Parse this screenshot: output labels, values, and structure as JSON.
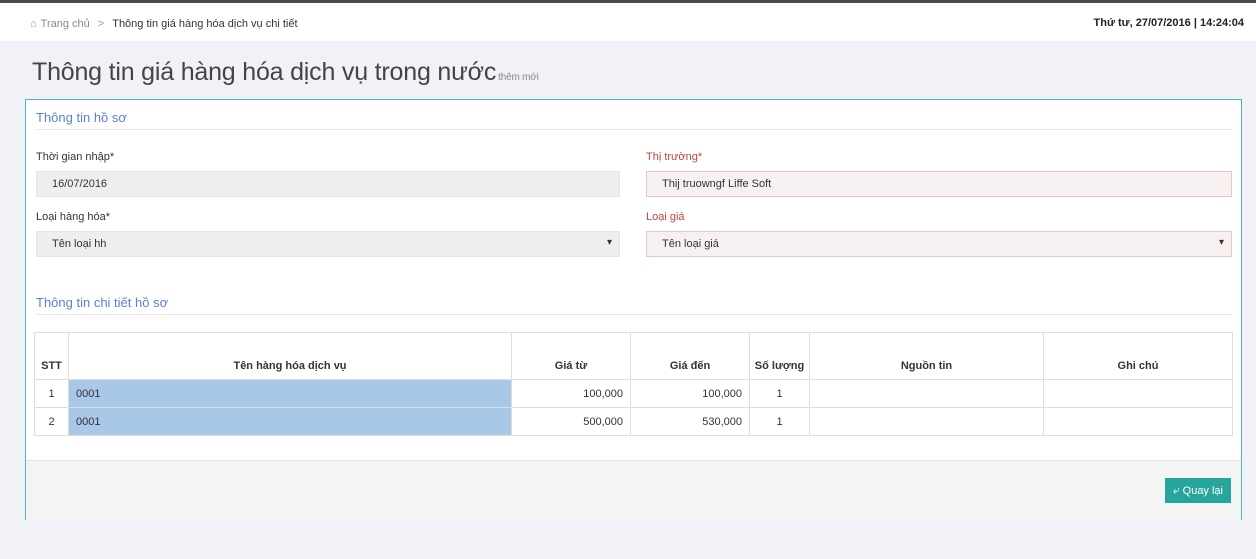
{
  "breadcrumb": {
    "home_label": "Trang chủ",
    "separator": ">",
    "current": "Thông tin giá hàng hóa dịch vụ chi tiết"
  },
  "datetime": "Thứ tư, 27/07/2016 | 14:24:04",
  "page": {
    "title": "Thông tin giá hàng hóa dịch vụ trong nước",
    "subtitle": "thêm mới"
  },
  "section1": {
    "title": "Thông tin hồ sơ"
  },
  "form": {
    "thoi_gian_label": "Thời gian nhập*",
    "thoi_gian_value": "16/07/2016",
    "thi_truong_label": "Thị trường*",
    "thi_truong_value": "Thij truowngf Liffe Soft",
    "loai_hang_label": "Loại hàng hóa*",
    "loai_hang_value": "Tên loại hh",
    "loai_gia_label": "Loại giá",
    "loai_gia_value": "Tên loại giá"
  },
  "section2": {
    "title": "Thông tin chi tiết hồ sơ"
  },
  "table": {
    "headers": [
      "STT",
      "Tên hàng hóa dịch vụ",
      "Giá từ",
      "Giá đến",
      "Số lượng",
      "Nguồn tin",
      "Ghi chú"
    ],
    "rows": [
      {
        "stt": "1",
        "ten": "0001",
        "gia_tu": "100,000",
        "gia_den": "100,000",
        "so_luong": "1",
        "nguon_tin": "",
        "ghi_chu": ""
      },
      {
        "stt": "2",
        "ten": "0001",
        "gia_tu": "500,000",
        "gia_den": "530,000",
        "so_luong": "1",
        "nguon_tin": "",
        "ghi_chu": ""
      }
    ]
  },
  "buttons": {
    "back_label": "Quay lại"
  },
  "colors": {
    "accent": "#26a69a",
    "section_title": "#5b7fd6",
    "selected_cell": "#a9c7e7",
    "portlet_border": "#4db3c5"
  },
  "icons": {
    "home": "home-icon",
    "back": "reply-arrow-icon",
    "dropdown": "caret-down-icon"
  }
}
